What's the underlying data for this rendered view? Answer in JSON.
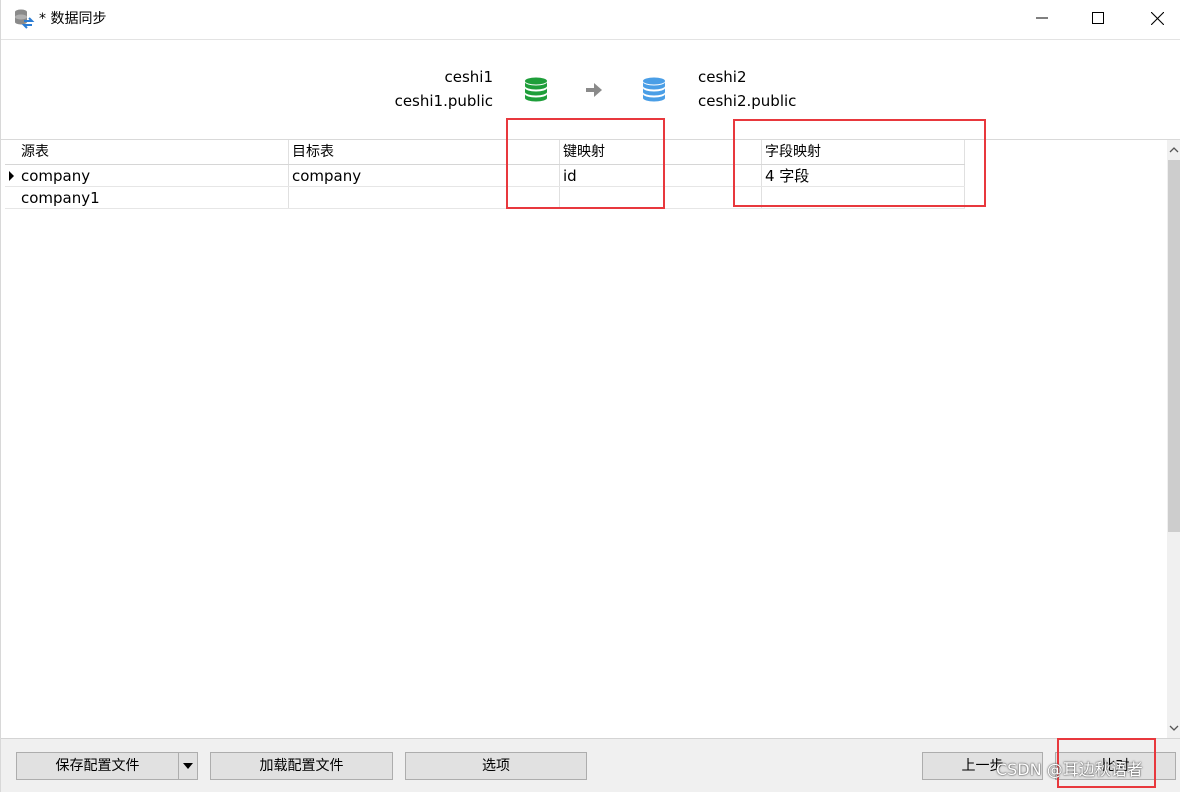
{
  "window": {
    "title": "* 数据同步"
  },
  "connection": {
    "source_name": "ceshi1",
    "source_schema": "ceshi1.public",
    "target_name": "ceshi2",
    "target_schema": "ceshi2.public",
    "source_icon": "database-green-icon",
    "target_icon": "database-blue-icon",
    "source_color": "#1e9e3a",
    "target_color": "#4a9ee6"
  },
  "table": {
    "headers": {
      "source": "源表",
      "target": "目标表",
      "key_mapping": "键映射",
      "field_mapping": "字段映射"
    },
    "rows": [
      {
        "source": "company",
        "target": "company",
        "key_mapping": "id",
        "field_mapping": "4 字段"
      },
      {
        "source": "company1",
        "target": "",
        "key_mapping": "",
        "field_mapping": ""
      }
    ]
  },
  "buttons": {
    "save_config": "保存配置文件",
    "load_config": "加载配置文件",
    "options": "选项",
    "previous": "上一步",
    "compare": "比对"
  },
  "watermark": "CSDN @耳边秋语者",
  "colors": {
    "annotation_red": "#e8383d"
  }
}
